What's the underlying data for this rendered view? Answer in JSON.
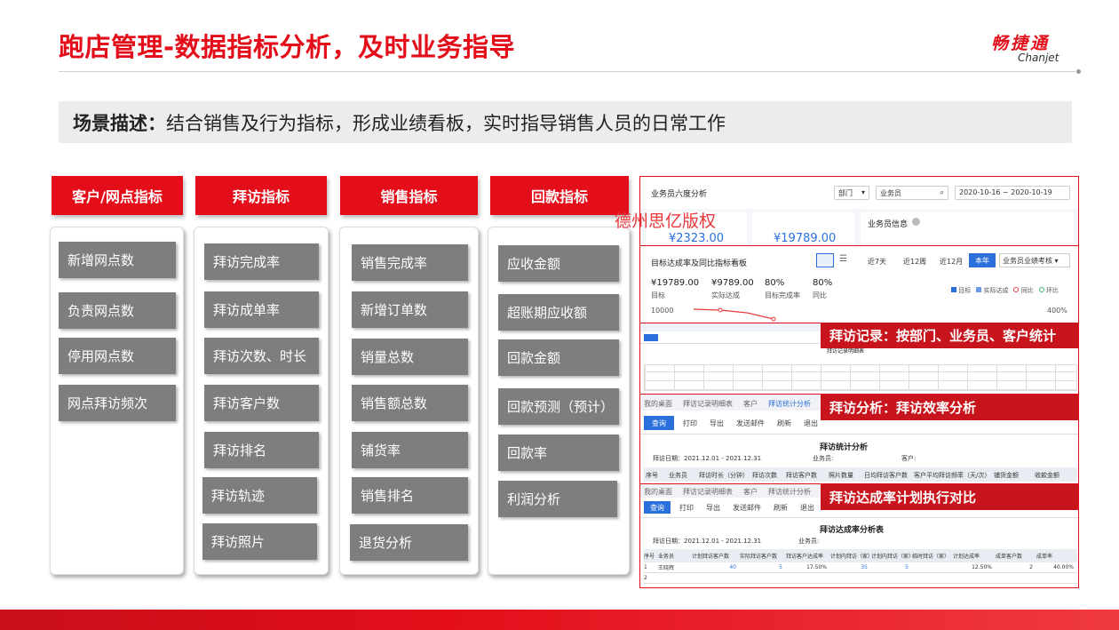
{
  "title": "跑店管理-数据指标分析，及时业务指导",
  "logo": {
    "cn": "畅捷通",
    "en": "Chanjet"
  },
  "scene": {
    "label": "场景描述：",
    "text": "结合销售及行为指标，形成业绩看板，实时指导销售人员的日常工作"
  },
  "columns": [
    {
      "header": "客户/网点指标",
      "items": [
        "新增网点数",
        "负责网点数",
        "停用网点数",
        "网点拜访频次"
      ]
    },
    {
      "header": "拜访指标",
      "items": [
        "拜访完成率",
        "拜访成单率",
        "拜访次数、时长",
        "拜访客户数",
        "拜访排名",
        "拜访轨迹",
        "拜访照片"
      ]
    },
    {
      "header": "销售指标",
      "items": [
        "销售完成率",
        "新增订单数",
        "销量总数",
        "销售额总数",
        "铺货率",
        "销售排名",
        "退货分析"
      ]
    },
    {
      "header": "回款指标",
      "items": [
        "应收金额",
        "超账期应收额",
        "回款金额",
        "回款预测（预计）",
        "回款率",
        "利润分析"
      ]
    }
  ],
  "watermark": "德州思亿版权",
  "panel": {
    "six": {
      "title": "业务员六度分析",
      "dept": "部门",
      "salesman": "业务员",
      "date": "2020-10-16 ~ 2020-10-19",
      "v1": "¥2323.00",
      "v2": "¥19789.00",
      "info": "业务员信息"
    },
    "target": {
      "title": "目标达成率及同比指标看板",
      "ranges": [
        "近7天",
        "近12周",
        "近12月",
        "本年"
      ],
      "select": "业务员业绩考核",
      "stats": [
        {
          "value": "¥19789.00",
          "label": "目标"
        },
        {
          "value": "¥9789.00",
          "label": "实际达成"
        },
        {
          "value": "80%",
          "label": "目标完成率"
        },
        {
          "value": "80%",
          "label": "同比"
        }
      ],
      "legend": [
        "目标",
        "实际达成",
        "同比",
        "环比"
      ],
      "axis_left": "10000",
      "axis_right": "400%"
    },
    "visit_record": {
      "tag": "拜访记录：按部门、业务员、客户统计",
      "subtitle": "拜访记录明细表"
    },
    "visit_analysis": {
      "tag": "拜访分析：拜访效率分析",
      "tabs": [
        "我的桌面",
        "拜访记录明细表",
        "客户",
        "拜访统计分析"
      ],
      "query": "查询",
      "actions": [
        "打印",
        "导出",
        "发送邮件",
        "刷新",
        "退出"
      ],
      "report_title": "拜访统计分析",
      "period": "拜访日期：2021.12.01 - 2021.12.31",
      "salesman": "业务员:",
      "customer": "客户:",
      "headers": [
        "序号",
        "业务员",
        "拜访时长（分钟）",
        "拜访次数",
        "拜访客户数",
        "照片数量",
        "日均拜访客户数",
        "客户平均拜访频率（天/次）",
        "铺货金额",
        "收款金额"
      ]
    },
    "achievement": {
      "tag": "拜访达成率计划执行对比",
      "tabs": [
        "我的桌面",
        "拜访记录明细表",
        "客户",
        "拜访统计分析"
      ],
      "query": "查询",
      "actions": [
        "打印",
        "导出",
        "发送邮件",
        "刷新",
        "退出"
      ],
      "report_title": "拜访达成率分析表",
      "period": "拜访日期：2021.12.01 - 2021.12.31",
      "salesman": "业务员:",
      "headers": [
        "序号",
        "业务员",
        "计划拜访客户数",
        "实际拜访客户数",
        "拜访客户达成率",
        "计划内拜访（家）",
        "计划内拜访（家）",
        "临时拜访（家）",
        "计划达成率",
        "成单客户数",
        "成单率"
      ],
      "rows": [
        [
          "1",
          "王晓辉",
          "40",
          "5",
          "17.50%",
          "35",
          "5",
          "",
          "12.50%",
          "2",
          "40.00%"
        ],
        [
          "2",
          "",
          "",
          "",
          "",
          "",
          "",
          "",
          "",
          "",
          ""
        ]
      ]
    }
  },
  "colors": {
    "accent": "#e30e1a",
    "item_bg": "#7e7e7e",
    "blue": "#2a6fdb"
  }
}
